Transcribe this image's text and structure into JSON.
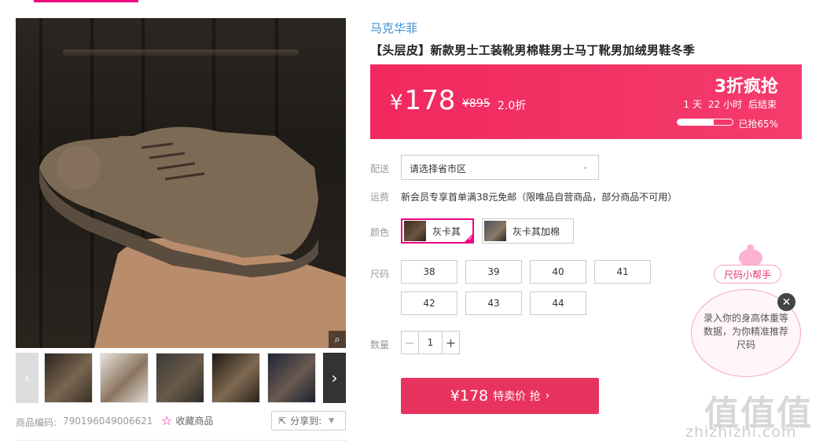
{
  "gallery": {
    "zoom_icon": "magnifier-icon",
    "prev_icon": "chevron-left-icon",
    "next_icon": "chevron-right-icon",
    "thumbnail_count": 5
  },
  "product_meta": {
    "code_label": "商品编码:",
    "code_value": "790196049006621",
    "favorite_label": "收藏商品",
    "share_label": "分享到:"
  },
  "product": {
    "brand": "马克华菲",
    "title": "【头层皮】新款男士工装靴男棉鞋男士马丁靴男加绒男鞋冬季"
  },
  "price_bar": {
    "currency": "¥",
    "price": "178",
    "original_price": "¥895",
    "discount": "2.0折",
    "promo_title": "3折疯抢",
    "countdown_days": "1",
    "countdown_day_unit": "天",
    "countdown_hours": "22",
    "countdown_hour_unit": "小时",
    "countdown_suffix": "后结束",
    "sold_percent": 65,
    "sold_text": "已抢65%",
    "accent_color": "#f1285e"
  },
  "delivery": {
    "label": "配送",
    "placeholder": "请选择省市区"
  },
  "shipping": {
    "label": "运费",
    "text": "新会员专享首单满38元免邮（限唯品自营商品，部分商品不可用）"
  },
  "color": {
    "label": "颜色",
    "options": [
      {
        "name": "灰卡其",
        "selected": true
      },
      {
        "name": "灰卡其加棉",
        "selected": false
      }
    ]
  },
  "size": {
    "label": "尺码",
    "options": [
      "38",
      "39",
      "40",
      "41",
      "42",
      "43",
      "44"
    ]
  },
  "quantity": {
    "label": "数量",
    "value": "1"
  },
  "buy": {
    "price": "¥178",
    "label": "特卖价 抢",
    "arrow": "›"
  },
  "size_helper": {
    "tag": "尺码小帮手",
    "bubble_text": "录入你的身高体重等数据，为你精准推荐尺码"
  },
  "watermark": {
    "logo": "值值值",
    "url": "zhizhizhi.com"
  }
}
